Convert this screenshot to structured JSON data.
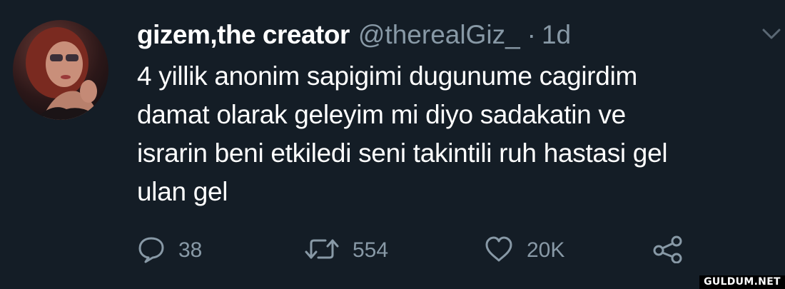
{
  "tweet": {
    "display_name": "gizem,the creator",
    "handle": "@therealGiz_",
    "separator": "·",
    "time": "1d",
    "text_lines": [
      "4 yillik anonim sapigimi dugunume cagirdim",
      "damat olarak geleyim mi diyo sadakatin ve",
      "israrin beni etkiledi seni takintili ruh hastasi gel",
      "ulan gel"
    ],
    "actions": {
      "reply_count": "38",
      "retweet_count": "554",
      "like_count": "20K"
    }
  },
  "icons": {
    "reply": "reply-bubble-icon",
    "retweet": "retweet-icon",
    "like": "heart-icon",
    "share": "share-icon",
    "menu": "chevron-down-icon"
  },
  "colors": {
    "background": "#141d26",
    "primary_text": "#ffffff",
    "secondary_text": "#8899a6"
  },
  "watermark": "GULDUM.NET"
}
